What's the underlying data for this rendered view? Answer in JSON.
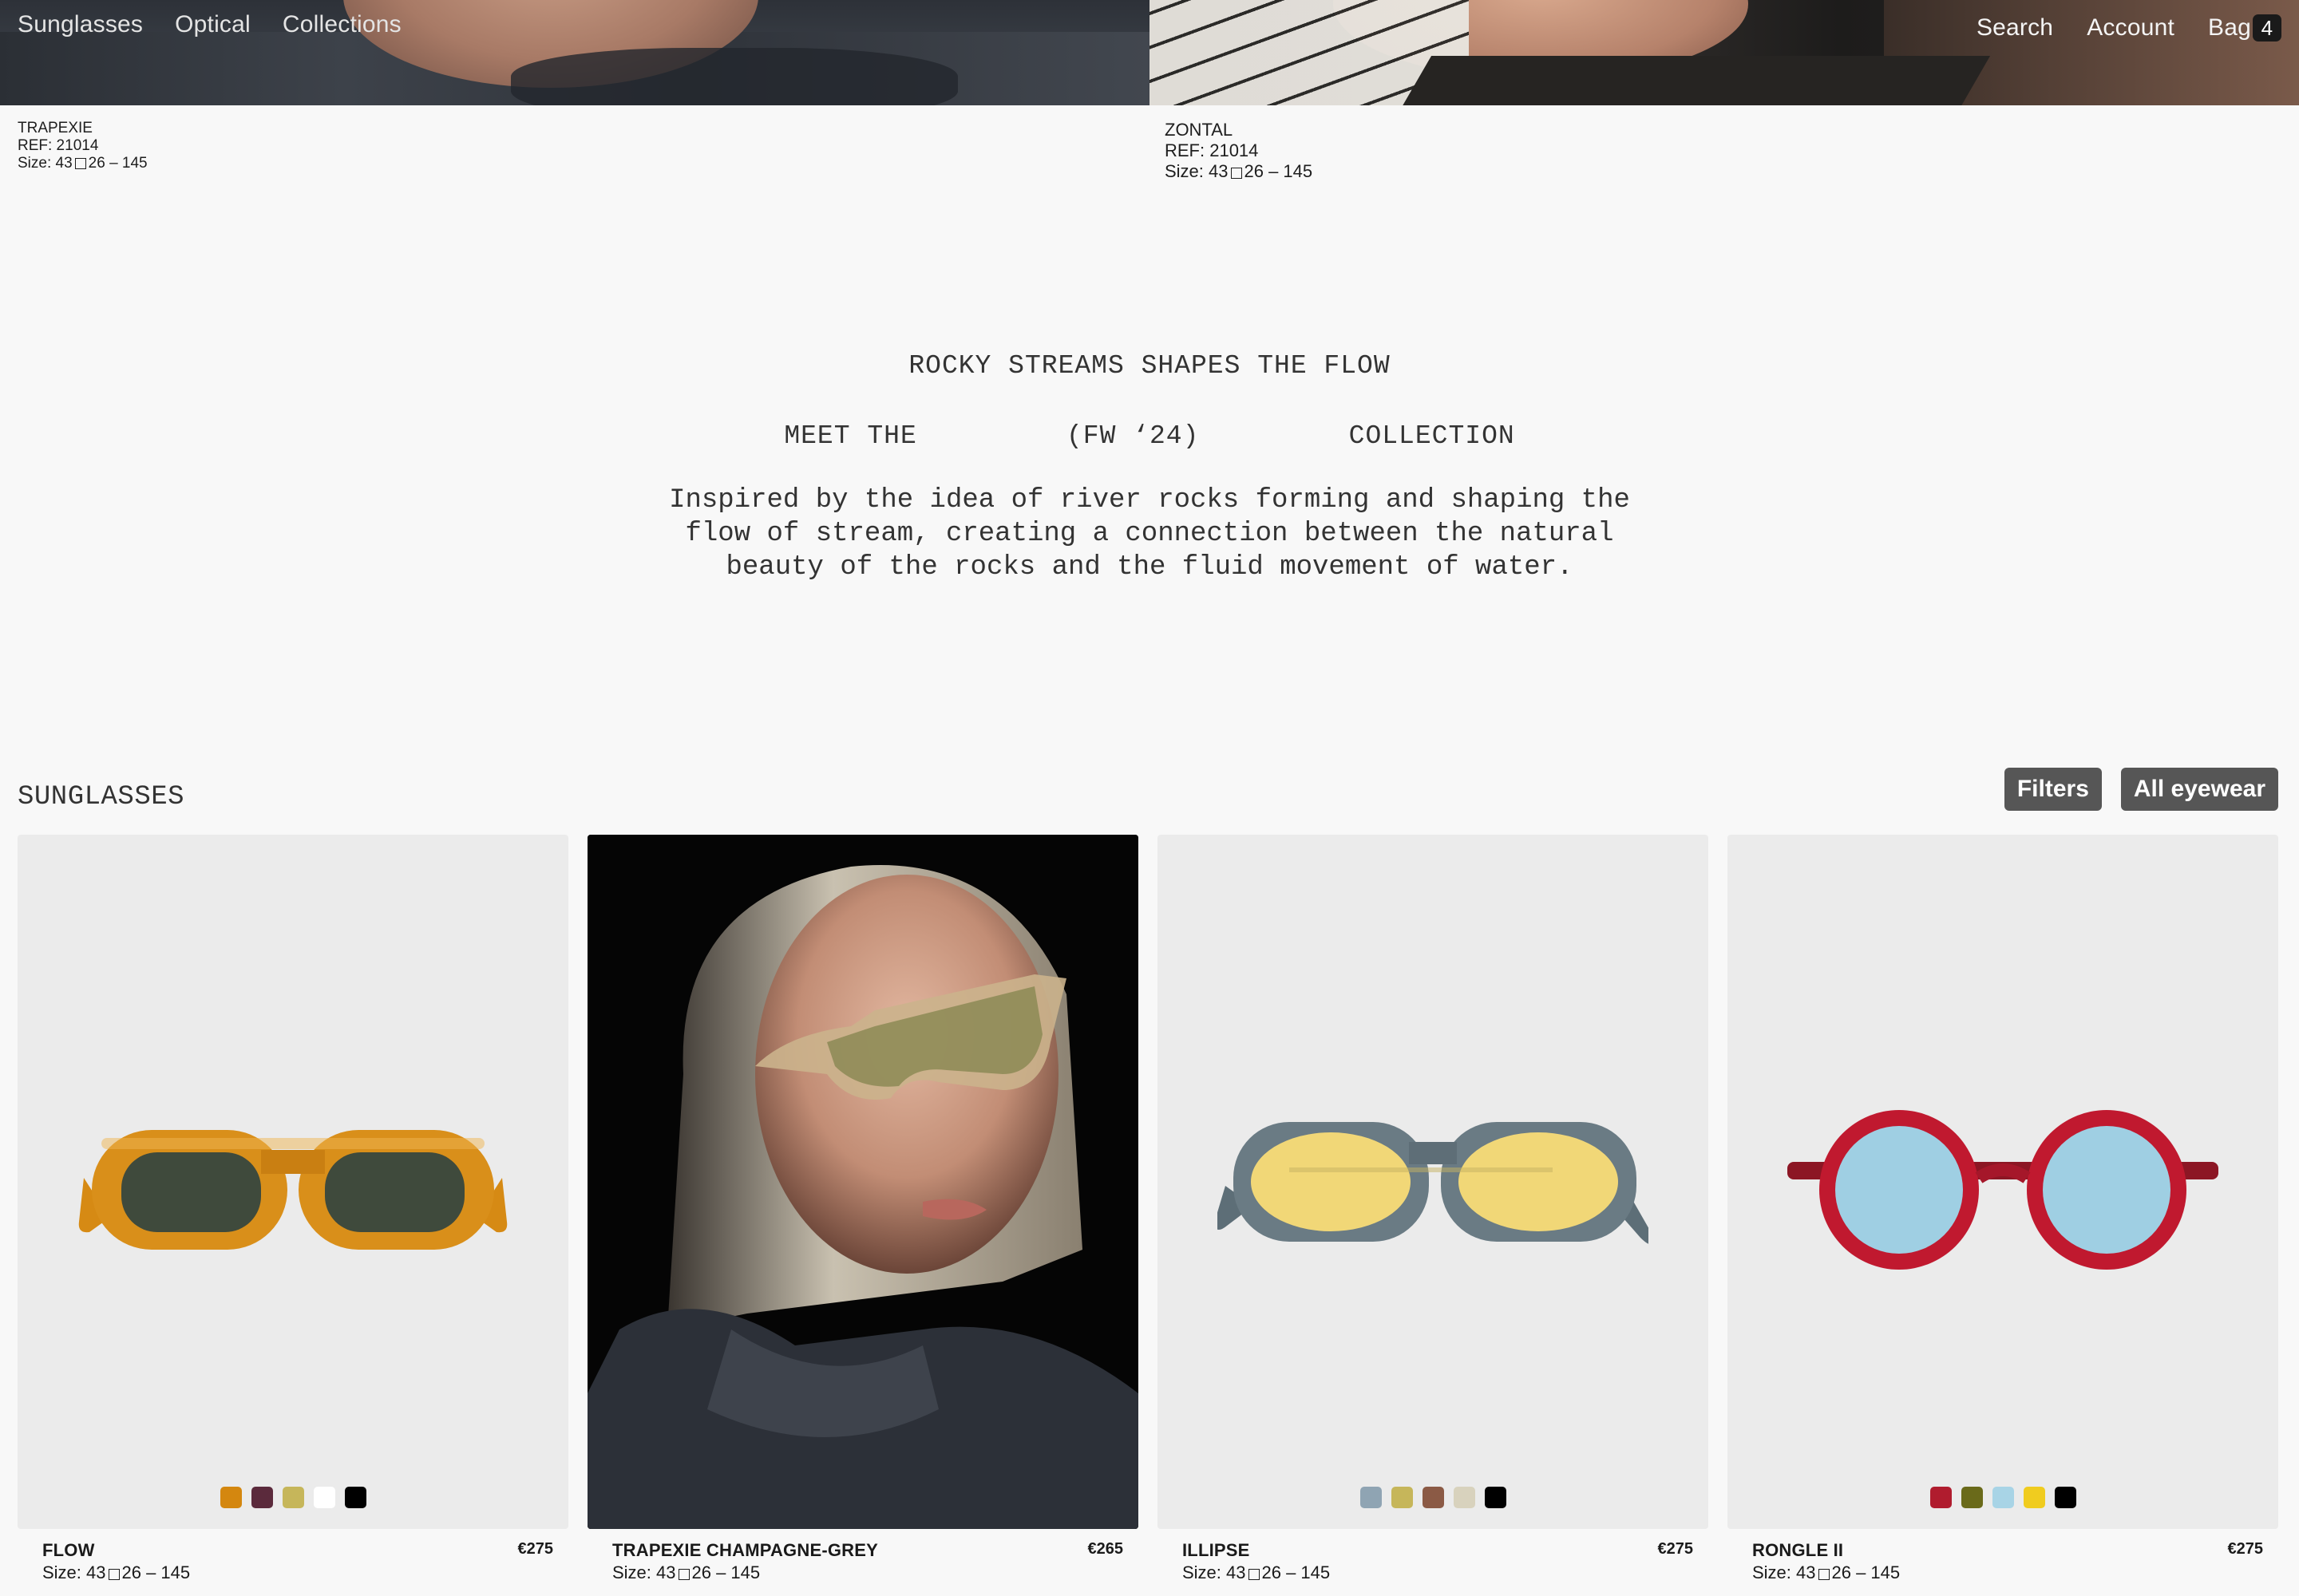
{
  "nav": {
    "left": [
      "Sunglasses",
      "Optical",
      "Collections"
    ],
    "search": "Search",
    "account": "Account",
    "bag": "Bag",
    "bag_count": "4"
  },
  "hero_products": [
    {
      "name": "TRAPEXIE",
      "ref": "REF: 21014",
      "size_label": "Size: 43",
      "size_rest": "26 – 145"
    },
    {
      "name": "ZONTAL",
      "ref": "REF: 21014",
      "size_label": "Size: 43",
      "size_rest": "26 – 145"
    }
  ],
  "intro": {
    "title": "ROCKY STREAMS SHAPES THE FLOW",
    "subtitle": "MEET THE         (FW ‘24)         COLLECTION",
    "text": "Inspired by the idea of river rocks forming and shaping the flow of stream, creating a connection between the natural beauty of the rocks and the fluid movement of water."
  },
  "section": {
    "title": "SUNGLASSES",
    "filters": "Filters",
    "all_eyewear": "All eyewear"
  },
  "products": [
    {
      "name": "FLOW",
      "price": "€275",
      "size_label": "Size: 43",
      "size_rest": "26 – 145",
      "icon": "orange-oval-sunglasses",
      "swatches": [
        "#d4870f",
        "#5b2a3c",
        "#c6b65a",
        "#ffffff",
        "#000000"
      ]
    },
    {
      "name": "TRAPEXIE CHAMPAGNE-GREY",
      "price": "€265",
      "size_label": "Size: 43",
      "size_rest": "26 – 145",
      "icon": "model-photo",
      "swatches": []
    },
    {
      "name": "ILLIPSE",
      "price": "€275",
      "size_label": "Size: 43",
      "size_rest": "26 – 145",
      "icon": "grey-oval-sunglasses",
      "swatches": [
        "#8fa4b3",
        "#c6b65a",
        "#8b5a45",
        "#d8d2bd",
        "#000000"
      ]
    },
    {
      "name": "RONGLE II",
      "price": "€275",
      "size_label": "Size: 43",
      "size_rest": "26 – 145",
      "icon": "red-round-sunglasses",
      "swatches": [
        "#b01c2e",
        "#6a6a1a",
        "#a8d4e6",
        "#f0cc1f",
        "#000000"
      ]
    }
  ]
}
